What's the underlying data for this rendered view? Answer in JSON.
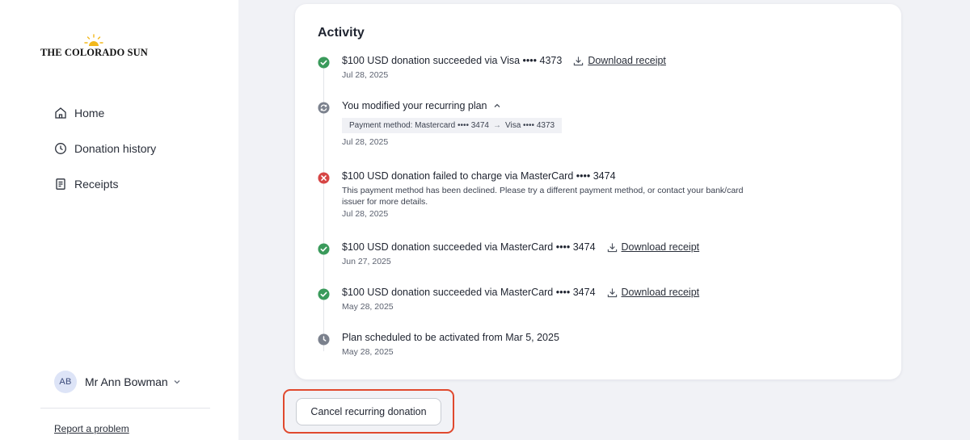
{
  "brand": {
    "logo_text": "THE COLORADO SUN"
  },
  "sidebar": {
    "items": [
      {
        "label": "Home",
        "icon": "home-icon"
      },
      {
        "label": "Donation history",
        "icon": "clock-icon"
      },
      {
        "label": "Receipts",
        "icon": "receipt-icon"
      }
    ],
    "user": {
      "initials": "AB",
      "name": "Mr Ann Bowman"
    },
    "report_link": "Report a problem"
  },
  "activity": {
    "title": "Activity",
    "events": [
      {
        "status": "success",
        "title": "$100 USD donation succeeded via Visa •••• 4373",
        "receipt_label": "Download receipt",
        "date": "Jul 28, 2025"
      },
      {
        "status": "modified",
        "title": "You modified your recurring plan",
        "change_label": "Payment method:",
        "change_from": "Mastercard •••• 3474",
        "change_arrow": "→",
        "change_to": "Visa •••• 4373",
        "date": "Jul 28, 2025"
      },
      {
        "status": "failed",
        "title": "$100 USD donation failed to charge via MasterCard •••• 3474",
        "description": "This payment method has been declined. Please try a different payment method, or contact your bank/card issuer for more details.",
        "date": "Jul 28, 2025"
      },
      {
        "status": "success",
        "title": "$100 USD donation succeeded via MasterCard •••• 3474",
        "receipt_label": "Download receipt",
        "date": "Jun 27, 2025"
      },
      {
        "status": "success",
        "title": "$100 USD donation succeeded via MasterCard •••• 3474",
        "receipt_label": "Download receipt",
        "date": "May 28, 2025"
      },
      {
        "status": "scheduled",
        "title": "Plan scheduled to be activated from Mar 5, 2025",
        "date": "May 28, 2025"
      }
    ]
  },
  "actions": {
    "cancel_label": "Cancel recurring donation"
  },
  "colors": {
    "success": "#3a9a5b",
    "failed": "#d64545",
    "neutral": "#6b7280",
    "highlight": "#e0492e",
    "logo_sun": "#f2b81c"
  }
}
